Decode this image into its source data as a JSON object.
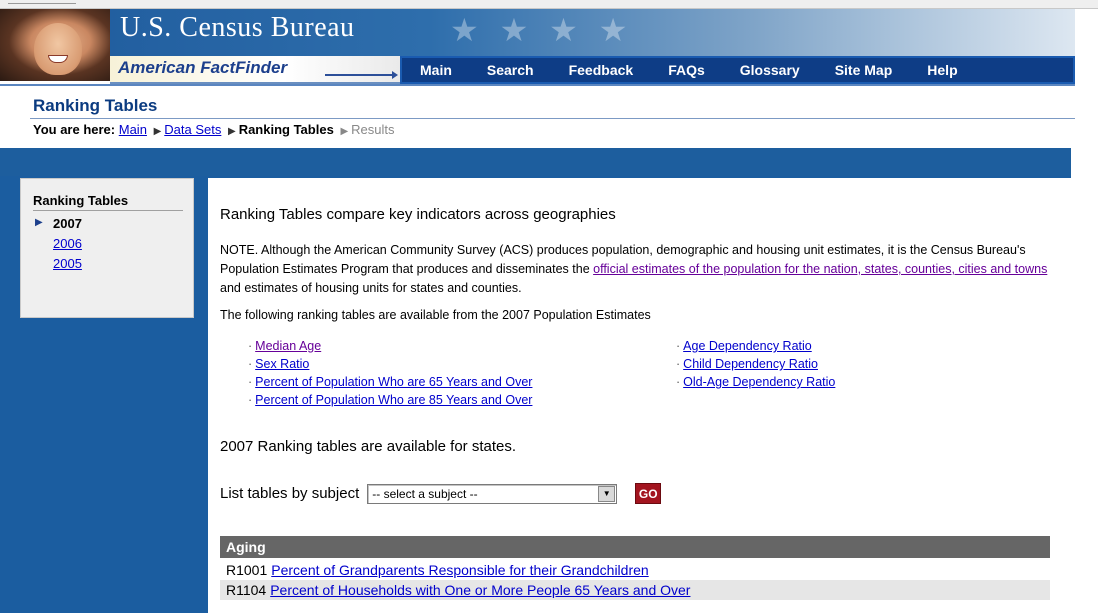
{
  "header": {
    "agency": "U.S. Census Bureau",
    "product": "American FactFinder",
    "nav": [
      "Main",
      "Search",
      "Feedback",
      "FAQs",
      "Glossary",
      "Site Map",
      "Help"
    ]
  },
  "page": {
    "title": "Ranking Tables",
    "breadcrumb": {
      "label": "You are here:",
      "main": "Main",
      "datasets": "Data Sets",
      "current": "Ranking Tables",
      "next": "Results"
    }
  },
  "sidebar": {
    "title": "Ranking Tables",
    "items": [
      {
        "label": "2007"
      },
      {
        "label": "2006"
      },
      {
        "label": "2005"
      }
    ]
  },
  "main": {
    "intro": "Ranking Tables compare key indicators across geographies",
    "note_pre": "NOTE. Although the American Community Survey (ACS) produces population, demographic and housing unit estimates, it is the Census Bureau's Population Estimates Program that produces and disseminates the ",
    "note_link": "official estimates of the population for the nation, states, counties, cities and towns",
    "note_post": " and estimates of housing units for states and counties.",
    "available": "The following ranking tables are available from the 2007 Population Estimates",
    "left_links": [
      "Median Age",
      "Sex Ratio",
      "Percent of Population Who are 65 Years and Over",
      "Percent of Population Who are 85 Years and Over"
    ],
    "right_links": [
      "Age Dependency Ratio",
      "Child Dependency Ratio",
      "Old-Age Dependency Ratio"
    ],
    "states_note": "2007 Ranking tables are available for states.",
    "subject_label": "List tables by subject",
    "subject_selected": "-- select a subject --",
    "go_label": "GO",
    "category": "Aging",
    "rows": [
      {
        "code": "R1001",
        "title": "Percent of Grandparents Responsible for their Grandchildren"
      },
      {
        "code": "R1104",
        "title": "Percent of Households with One or More People 65 Years and Over"
      }
    ]
  },
  "colors": {
    "frame_blue": "#1b5da0",
    "nav_blue": "#0e3d86",
    "go_red": "#a3141f",
    "category_gray": "#666666"
  }
}
